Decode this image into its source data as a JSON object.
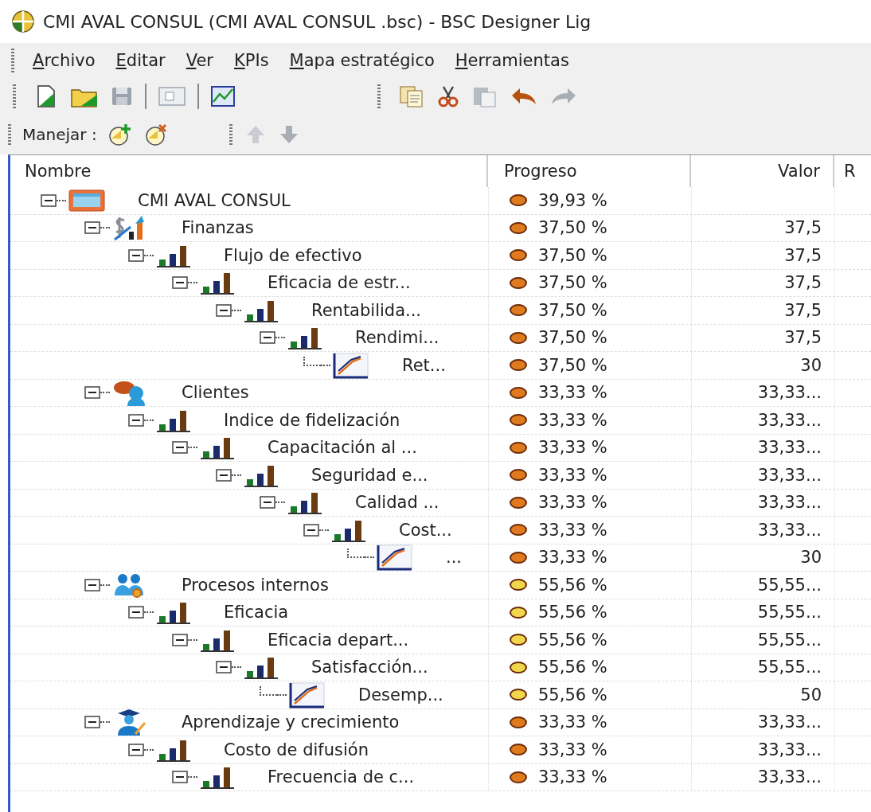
{
  "window": {
    "title": "CMI AVAL CONSUL (CMI AVAL CONSUL .bsc) - BSC Designer Lig"
  },
  "menu": [
    "Archivo",
    "Editar",
    "Ver",
    "KPIs",
    "Mapa estratégico",
    "Herramientas"
  ],
  "manage": {
    "label": "Manejar :"
  },
  "columns": [
    "Nombre",
    "Progreso",
    "Valor",
    "R"
  ],
  "tree": [
    {
      "name": "CMI AVAL CONSUL",
      "kind": "root",
      "expanded": true,
      "progress": "39,93 %",
      "color": "#e07a1f",
      "children": [
        {
          "name": "Finanzas",
          "kind": "finance",
          "expanded": true,
          "progress": "37,50 %",
          "value": "37,5",
          "color": "#e07a1f",
          "children": [
            {
              "name": "Flujo de efectivo",
              "kind": "group",
              "expanded": true,
              "progress": "37,50 %",
              "value": "37,5",
              "color": "#e07a1f",
              "children": [
                {
                  "name": "Eficacia de estr...",
                  "kind": "group",
                  "expanded": true,
                  "progress": "37,50 %",
                  "value": "37,5",
                  "color": "#e07a1f",
                  "children": [
                    {
                      "name": "Rentabilida...",
                      "kind": "group",
                      "expanded": true,
                      "progress": "37,50 %",
                      "value": "37,5",
                      "color": "#e07a1f",
                      "children": [
                        {
                          "name": "Rendimi...",
                          "kind": "group",
                          "expanded": true,
                          "progress": "37,50 %",
                          "value": "37,5",
                          "color": "#e07a1f",
                          "children": [
                            {
                              "name": "Ret...",
                              "kind": "kpi",
                              "progress": "37,50 %",
                              "value": "30",
                              "color": "#e07a1f"
                            }
                          ]
                        }
                      ]
                    }
                  ]
                }
              ]
            }
          ]
        },
        {
          "name": "Clientes",
          "kind": "customers",
          "expanded": true,
          "progress": "33,33 %",
          "value": "33,33...",
          "color": "#e07a1f",
          "children": [
            {
              "name": "Indice de fidelización",
              "kind": "group",
              "expanded": true,
              "progress": "33,33 %",
              "value": "33,33...",
              "color": "#e07a1f",
              "children": [
                {
                  "name": "Capacitación al ...",
                  "kind": "group",
                  "expanded": true,
                  "progress": "33,33 %",
                  "value": "33,33...",
                  "color": "#e07a1f",
                  "children": [
                    {
                      "name": "Seguridad e...",
                      "kind": "group",
                      "expanded": true,
                      "progress": "33,33 %",
                      "value": "33,33...",
                      "color": "#e07a1f",
                      "children": [
                        {
                          "name": "Calidad ...",
                          "kind": "group",
                          "expanded": true,
                          "progress": "33,33 %",
                          "value": "33,33...",
                          "color": "#e07a1f",
                          "children": [
                            {
                              "name": "Cost...",
                              "kind": "group",
                              "expanded": true,
                              "progress": "33,33 %",
                              "value": "33,33...",
                              "color": "#e07a1f",
                              "children": [
                                {
                                  "name": "...",
                                  "kind": "kpi",
                                  "progress": "33,33 %",
                                  "value": "30",
                                  "color": "#e07a1f"
                                }
                              ]
                            }
                          ]
                        }
                      ]
                    }
                  ]
                }
              ]
            }
          ]
        },
        {
          "name": "Procesos internos",
          "kind": "processes",
          "expanded": true,
          "progress": "55,56 %",
          "value": "55,55...",
          "color": "#f2d64b",
          "children": [
            {
              "name": "Eficacia",
              "kind": "group",
              "expanded": true,
              "progress": "55,56 %",
              "value": "55,55...",
              "color": "#f2d64b",
              "children": [
                {
                  "name": "Eficacia depart...",
                  "kind": "group",
                  "expanded": true,
                  "progress": "55,56 %",
                  "value": "55,55...",
                  "color": "#f2d64b",
                  "children": [
                    {
                      "name": "Satisfacción...",
                      "kind": "group",
                      "expanded": true,
                      "progress": "55,56 %",
                      "value": "55,55...",
                      "color": "#f2d64b",
                      "children": [
                        {
                          "name": "Desemp...",
                          "kind": "kpi",
                          "progress": "55,56 %",
                          "value": "50",
                          "color": "#f2d64b"
                        }
                      ]
                    }
                  ]
                }
              ]
            }
          ]
        },
        {
          "name": "Aprendizaje y crecimiento",
          "kind": "learning",
          "expanded": true,
          "progress": "33,33 %",
          "value": "33,33...",
          "color": "#e07a1f",
          "children": [
            {
              "name": "Costo de difusión",
              "kind": "group",
              "expanded": true,
              "progress": "33,33 %",
              "value": "33,33...",
              "color": "#e07a1f",
              "children": [
                {
                  "name": "Frecuencia de c...",
                  "kind": "group",
                  "expanded": true,
                  "progress": "33,33 %",
                  "value": "33,33...",
                  "color": "#e07a1f"
                }
              ]
            }
          ]
        }
      ]
    }
  ]
}
